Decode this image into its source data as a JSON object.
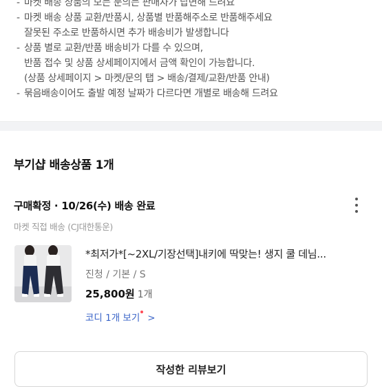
{
  "notice": {
    "bullet": "-",
    "lines": [
      {
        "bullet": true,
        "text": "마켓 배송 상품의 모든 문의는 판매자가 답변해 드려요"
      },
      {
        "bullet": true,
        "text": "마켓 배송 상품 교환/반품시, 상품별 반품해주소로 반품해주세요"
      },
      {
        "bullet": false,
        "text": "잘못된 주소로 반품하시면 추가 배송비가 발생합니다"
      },
      {
        "bullet": true,
        "text": "상품 별로 교환/반품 배송비가 다를 수 있으며,"
      },
      {
        "bullet": false,
        "text": "반품 접수 및 상품 상세페이지에서 금액 확인이 가능합니다."
      },
      {
        "bullet": false,
        "text": "(상품 상세페이지 > 마켓/문의 탭 > 배송/결제/교환/반품 안내)"
      },
      {
        "bullet": true,
        "text": "묶음배송이어도 출발 예정 날짜가 다르다면 개별로 배송해 드려요"
      }
    ]
  },
  "order": {
    "seller_title": "부기샵 배송상품 1개",
    "status": "구매확정 · 10/26(수) 배송 완료",
    "shipping_method": "마켓 직접 배송 (CJ대한통운)",
    "more_icon": "vertical-ellipsis-icon"
  },
  "product": {
    "name": "*최저가*[~2XL/기장선택]내키에 딱맞는! 생지 쿨 데님...",
    "option": "진청 / 기본 / S",
    "price": "25,800원",
    "quantity": "1개",
    "codi_link": "코디 1개 보기",
    "chevron": ">"
  },
  "review_button": "작성한 리뷰보기",
  "colors": {
    "link": "#3a64c8",
    "badge_dot": "#ff4b55",
    "divider": "#f2f3f5"
  }
}
